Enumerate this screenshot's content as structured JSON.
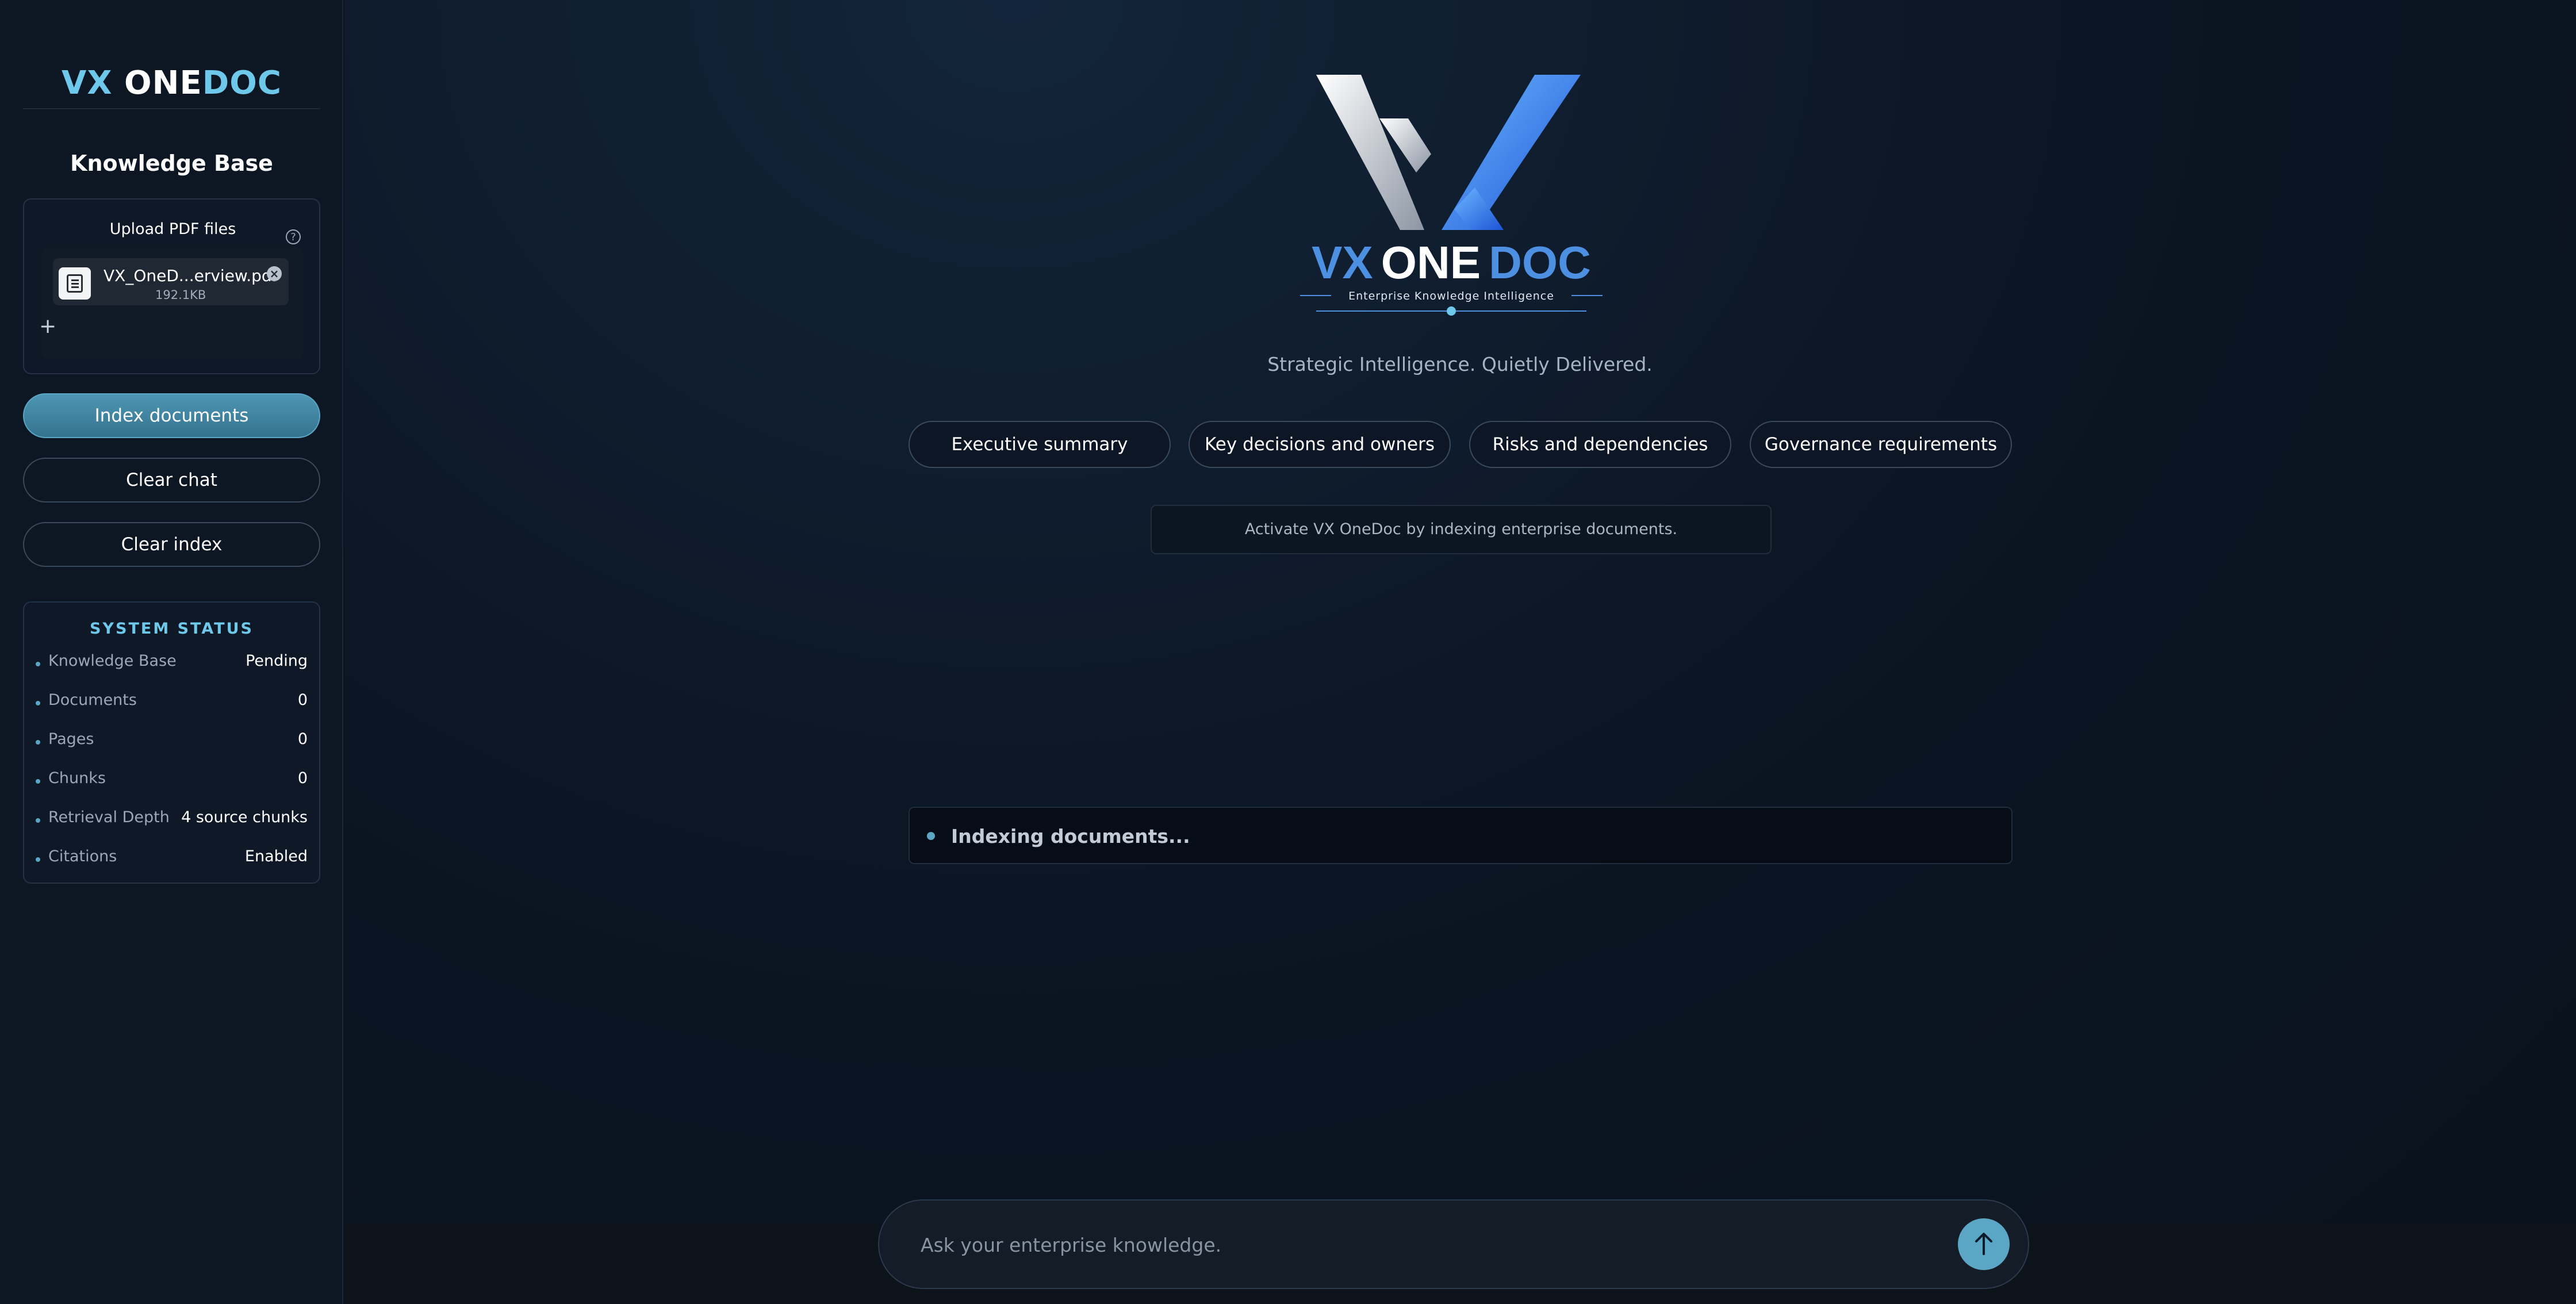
{
  "sidebar": {
    "brand": {
      "part1": "VX",
      "part2": "ONE",
      "part3": "DOC"
    },
    "kb_title": "Knowledge Base",
    "upload": {
      "label": "Upload PDF files",
      "help_icon": "question-circle-icon",
      "file": {
        "name": "VX_OneD...erview.pdf",
        "size": "192.1KB"
      },
      "add_icon": "plus-icon"
    },
    "buttons": {
      "index": "Index documents",
      "clear_chat": "Clear chat",
      "clear_index": "Clear index"
    },
    "status": {
      "title": "SYSTEM STATUS",
      "rows": [
        {
          "label": "Knowledge Base",
          "value": "Pending"
        },
        {
          "label": "Documents",
          "value": "0"
        },
        {
          "label": "Pages",
          "value": "0"
        },
        {
          "label": "Chunks",
          "value": "0"
        },
        {
          "label": "Retrieval Depth",
          "value": "4 source chunks"
        },
        {
          "label": "Citations",
          "value": "Enabled"
        }
      ]
    }
  },
  "main": {
    "logo": {
      "title_vx": "VX",
      "title_one": "ONE",
      "title_doc": "DOC",
      "subtitle": "Enterprise Knowledge Intelligence"
    },
    "tagline": "Strategic Intelligence. Quietly Delivered.",
    "chips": [
      "Executive summary",
      "Key decisions and owners",
      "Risks and dependencies",
      "Governance requirements"
    ],
    "hint": "Activate VX OneDoc by indexing enterprise documents.",
    "indexing": "Indexing documents...",
    "input": {
      "placeholder": "Ask your enterprise knowledge."
    },
    "send_icon": "arrow-up-icon"
  },
  "colors": {
    "accent": "#6ec8ea",
    "button": "#4d96b3",
    "background": "#0b1320"
  }
}
